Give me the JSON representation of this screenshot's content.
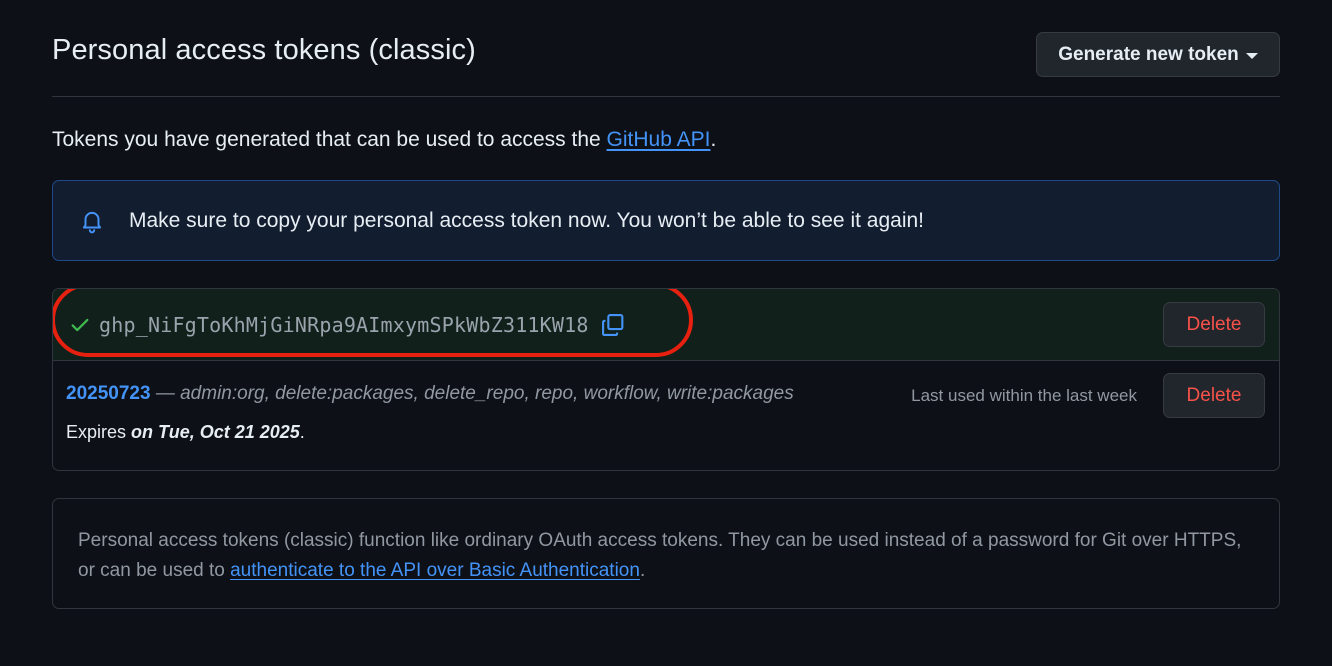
{
  "page": {
    "title": "Personal access tokens (classic)",
    "generate_button": "Generate new token"
  },
  "intro": {
    "text": "Tokens you have generated that can be used to access the ",
    "link": "GitHub API",
    "suffix": "."
  },
  "flash": {
    "icon": "bell-icon",
    "message": "Make sure to copy your personal access token now. You won’t be able to see it again!"
  },
  "new_token": {
    "value": "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",
    "delete_label": "Delete"
  },
  "token": {
    "name": "20250723",
    "separator": " — ",
    "scopes": "admin:org, delete:packages, delete_repo, repo, workflow, write:packages",
    "last_used": "Last used within the last week",
    "expires_label": "Expires ",
    "expires_date": "on Tue, Oct 21 2025",
    "expires_suffix": ".",
    "delete_label": "Delete"
  },
  "note": {
    "text": "Personal access tokens (classic) function like ordinary OAuth access tokens. They can be used instead of a password for Git over HTTPS, or can be used to ",
    "link": "authenticate to the API over Basic Authentication",
    "suffix": "."
  },
  "colors": {
    "background": "#0d1117",
    "link": "#4493f8",
    "danger": "#f85149",
    "success": "#3fb950",
    "highlight": "#e8200f"
  }
}
